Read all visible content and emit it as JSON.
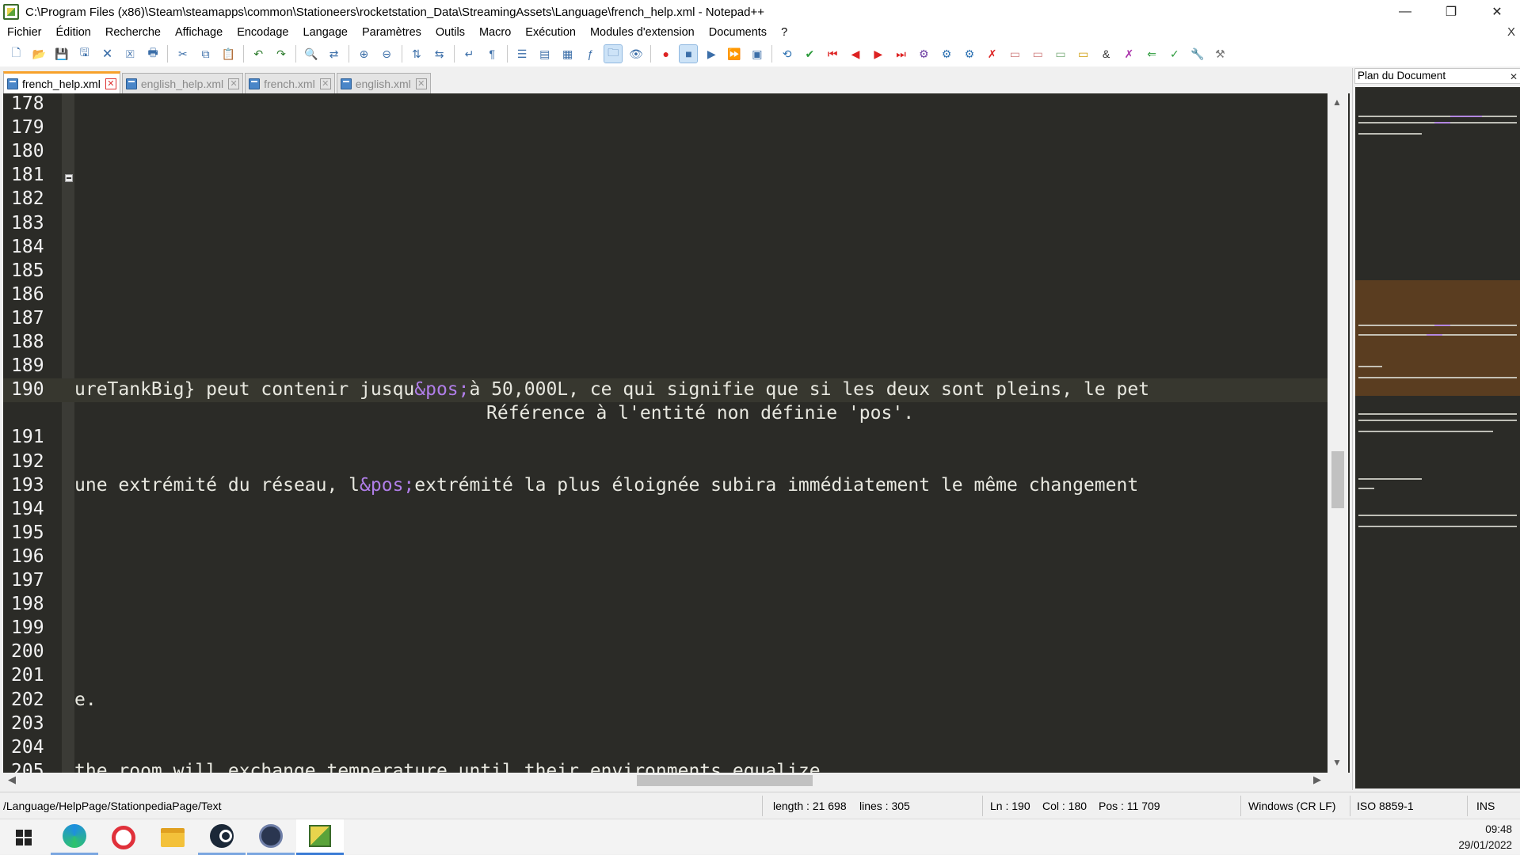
{
  "window": {
    "title": "C:\\Program Files (x86)\\Steam\\steamapps\\common\\Stationeers\\rocketstation_Data\\StreamingAssets\\Language\\french_help.xml - Notepad++",
    "minimize": "—",
    "maximize": "❐",
    "close": "✕"
  },
  "menu": {
    "items": [
      "Fichier",
      "Édition",
      "Recherche",
      "Affichage",
      "Encodage",
      "Langage",
      "Paramètres",
      "Outils",
      "Macro",
      "Exécution",
      "Modules d'extension",
      "Documents",
      "?"
    ],
    "close": "X"
  },
  "toolbar": {
    "icons": [
      "new-file-icon",
      "open-file-icon",
      "save-icon",
      "save-all-icon",
      "close-icon",
      "close-all-icon",
      "print-icon",
      "sep",
      "cut-icon",
      "copy-icon",
      "paste-icon",
      "sep",
      "undo-icon",
      "redo-icon",
      "sep",
      "find-icon",
      "replace-icon",
      "sep",
      "zoom-in-icon",
      "zoom-out-icon",
      "sep",
      "sync-vertical-icon",
      "sync-horizontal-icon",
      "sep",
      "word-wrap-icon",
      "show-all-chars-icon",
      "sep",
      "indent-guide-icon",
      "udl-icon",
      "doc-map-icon",
      "function-list-icon",
      "folder-workspace-icon",
      "monitoring-icon",
      "sep",
      "record-macro-icon",
      "stop-macro-icon",
      "play-macro-icon",
      "run-multiple-macro-icon",
      "save-macro-icon",
      "sep",
      "plugin-1-icon",
      "plugin-2-icon",
      "plugin-3-icon",
      "plugin-4-icon",
      "plugin-5-icon",
      "plugin-6-icon",
      "plugin-7-icon",
      "plugin-8-icon",
      "plugin-9-icon",
      "plugin-10-icon",
      "plugin-11-icon",
      "plugin-12-icon",
      "plugin-13-icon",
      "plugin-14-icon",
      "plugin-15-icon",
      "plugin-16-icon",
      "plugin-17-icon",
      "plugin-18-icon",
      "plugin-19-icon",
      "plugin-20-icon"
    ],
    "active": [
      24,
      27
    ]
  },
  "tabs": [
    {
      "label": "french_help.xml",
      "active": true
    },
    {
      "label": "english_help.xml",
      "active": false
    },
    {
      "label": "french.xml",
      "active": false
    },
    {
      "label": "english.xml",
      "active": false
    }
  ],
  "editor": {
    "current_line": 190,
    "lines": [
      {
        "n": "178",
        "parts": []
      },
      {
        "n": "179",
        "parts": []
      },
      {
        "n": "180",
        "parts": []
      },
      {
        "n": "181",
        "parts": []
      },
      {
        "n": "182",
        "parts": []
      },
      {
        "n": "183",
        "parts": []
      },
      {
        "n": "184",
        "parts": []
      },
      {
        "n": "185",
        "parts": []
      },
      {
        "n": "186",
        "parts": []
      },
      {
        "n": "187",
        "parts": []
      },
      {
        "n": "188",
        "parts": []
      },
      {
        "n": "189",
        "parts": []
      },
      {
        "n": "190",
        "parts": [
          {
            "t": "ureTankBig} peut contenir jusqu",
            "e": false
          },
          {
            "t": "&pos;",
            "e": true
          },
          {
            "t": "à 50,000L, ce qui signifie que si les deux sont pleins, le pet",
            "e": false
          }
        ]
      },
      {
        "n": "",
        "annotation": "Référence à l'entité non définie 'pos'.",
        "parts": []
      },
      {
        "n": "191",
        "parts": []
      },
      {
        "n": "192",
        "parts": []
      },
      {
        "n": "193",
        "parts": [
          {
            "t": "une extrémité du réseau, l",
            "e": false
          },
          {
            "t": "&pos;",
            "e": true
          },
          {
            "t": "extrémité la plus éloignée subira immédiatement le même changement",
            "e": false
          }
        ]
      },
      {
        "n": "194",
        "parts": []
      },
      {
        "n": "195",
        "parts": []
      },
      {
        "n": "196",
        "parts": []
      },
      {
        "n": "197",
        "parts": []
      },
      {
        "n": "198",
        "parts": []
      },
      {
        "n": "199",
        "parts": []
      },
      {
        "n": "200",
        "parts": []
      },
      {
        "n": "201",
        "parts": []
      },
      {
        "n": "202",
        "parts": [
          {
            "t": "e.",
            "e": false
          }
        ]
      },
      {
        "n": "203",
        "parts": []
      },
      {
        "n": "204",
        "parts": []
      },
      {
        "n": "205",
        "parts": [
          {
            "t": "the room will exchange temperature until their environments equalize",
            "e": false
          }
        ]
      }
    ]
  },
  "docmap": {
    "title": "Plan du Document",
    "close": "✕"
  },
  "status": {
    "path": "/Language/HelpPage/StationpediaPage/Text",
    "length": "length : 21 698",
    "lines": "lines : 305",
    "ln": "Ln : 190",
    "col": "Col : 180",
    "pos": "Pos : 11 709",
    "eol": "Windows (CR LF)",
    "encoding": "ISO 8859-1",
    "mode": "INS"
  },
  "taskbar": {
    "apps": [
      "windows-start",
      "edge",
      "opera",
      "file-explorer",
      "steam",
      "stationeers",
      "notepad-plus-plus"
    ],
    "time": "09:48",
    "date": "29/01/2022"
  }
}
